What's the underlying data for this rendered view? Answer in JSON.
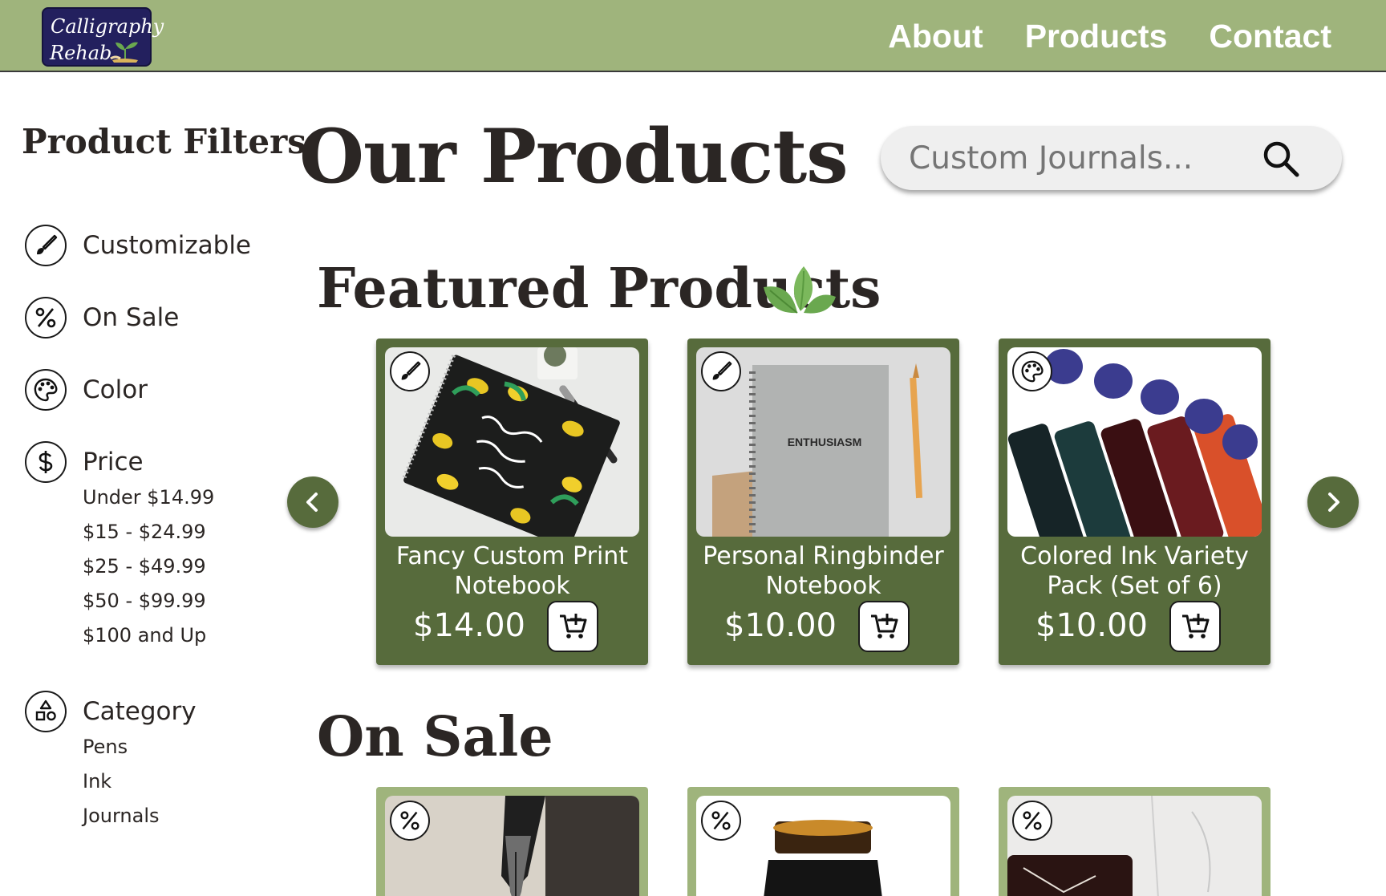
{
  "header": {
    "logo": {
      "line1": "Calligraphy",
      "line2": "Rehab"
    },
    "nav": [
      "About",
      "Products",
      "Contact"
    ],
    "bg_color": "#9fb47c"
  },
  "sidebar": {
    "title": "Product Filters",
    "filters": [
      {
        "label": "Customizable",
        "icon": "paintbrush-icon"
      },
      {
        "label": "On Sale",
        "icon": "percent-icon"
      },
      {
        "label": "Color",
        "icon": "palette-icon"
      },
      {
        "label": "Price",
        "icon": "dollar-icon"
      },
      {
        "label": "Category",
        "icon": "shapes-icon"
      }
    ],
    "price_options": [
      "Under $14.99",
      "$15 - $24.99",
      "$25 - $49.99",
      "$50 - $99.99",
      "$100 and Up"
    ],
    "category_options": [
      "Pens",
      "Ink",
      "Journals"
    ]
  },
  "main": {
    "title": "Our Products",
    "search": {
      "placeholder": "Custom Journals...",
      "icon": "search-icon"
    },
    "featured": {
      "title": "Featured Products",
      "products": [
        {
          "name": "Fancy Custom Print Notebook",
          "price": "$14.00",
          "badge": "paintbrush-icon",
          "image": "lemon-notebook"
        },
        {
          "name": "Personal Ringbinder Notebook",
          "price": "$10.00",
          "badge": "paintbrush-icon",
          "image": "grey-notebook",
          "image_text": "ENTHUSIASM"
        },
        {
          "name": "Colored Ink Variety Pack (Set of 6)",
          "price": "$10.00",
          "badge": "palette-icon",
          "image": "ink-bottles"
        }
      ]
    },
    "on_sale": {
      "title": "On Sale",
      "products": [
        {
          "badge": "percent-icon",
          "image": "fountain-pen-nib"
        },
        {
          "badge": "percent-icon",
          "image": "ink-jar"
        },
        {
          "badge": "percent-icon",
          "image": "marble-journal"
        }
      ]
    }
  },
  "colors": {
    "accent_green": "#9fb47c",
    "card_green": "#576b3c",
    "logo_navy": "#23205e",
    "text_dark": "#2b2624"
  }
}
